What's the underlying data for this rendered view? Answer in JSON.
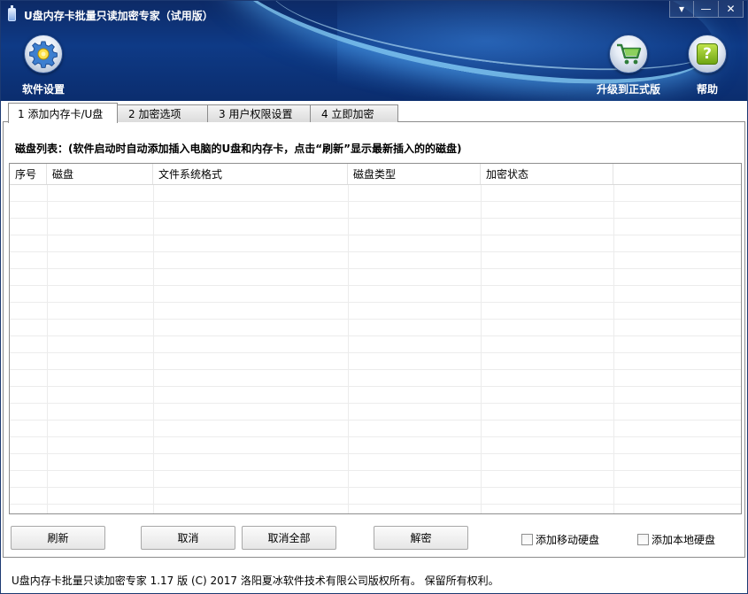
{
  "window": {
    "title": "U盘内存卡批量只读加密专家（试用版）",
    "controls": {
      "menu": "▾",
      "minimize": "—",
      "close": "✕"
    }
  },
  "toolbar": {
    "settings_label": "软件设置",
    "upgrade_label": "升级到正式版",
    "help_label": "帮助",
    "help_glyph": "?"
  },
  "tabs": [
    {
      "label": "1 添加内存卡/U盘",
      "active": true
    },
    {
      "label": "2 加密选项",
      "active": false
    },
    {
      "label": "3 用户权限设置",
      "active": false
    },
    {
      "label": "4 立即加密",
      "active": false
    }
  ],
  "disk_list": {
    "caption": "磁盘列表：(软件启动时自动添加插入电脑的U盘和内存卡，点击“刷新”显示最新插入的的磁盘)",
    "columns": [
      "序号",
      "磁盘",
      "文件系统格式",
      "磁盘类型",
      "加密状态",
      ""
    ],
    "rows": []
  },
  "actions": {
    "refresh": "刷新",
    "cancel": "取消",
    "cancel_all": "取消全部",
    "decrypt": "解密"
  },
  "options": {
    "add_removable": {
      "label": "添加移动硬盘",
      "checked": false
    },
    "add_local": {
      "label": "添加本地硬盘",
      "checked": false
    }
  },
  "status_bar": "U盘内存卡批量只读加密专家 1.17 版  (C)  2017 洛阳夏冰软件技术有限公司版权所有。 保留所有权利。",
  "colors": {
    "header": "#0e3a86",
    "accent": "#8cd7ff"
  }
}
